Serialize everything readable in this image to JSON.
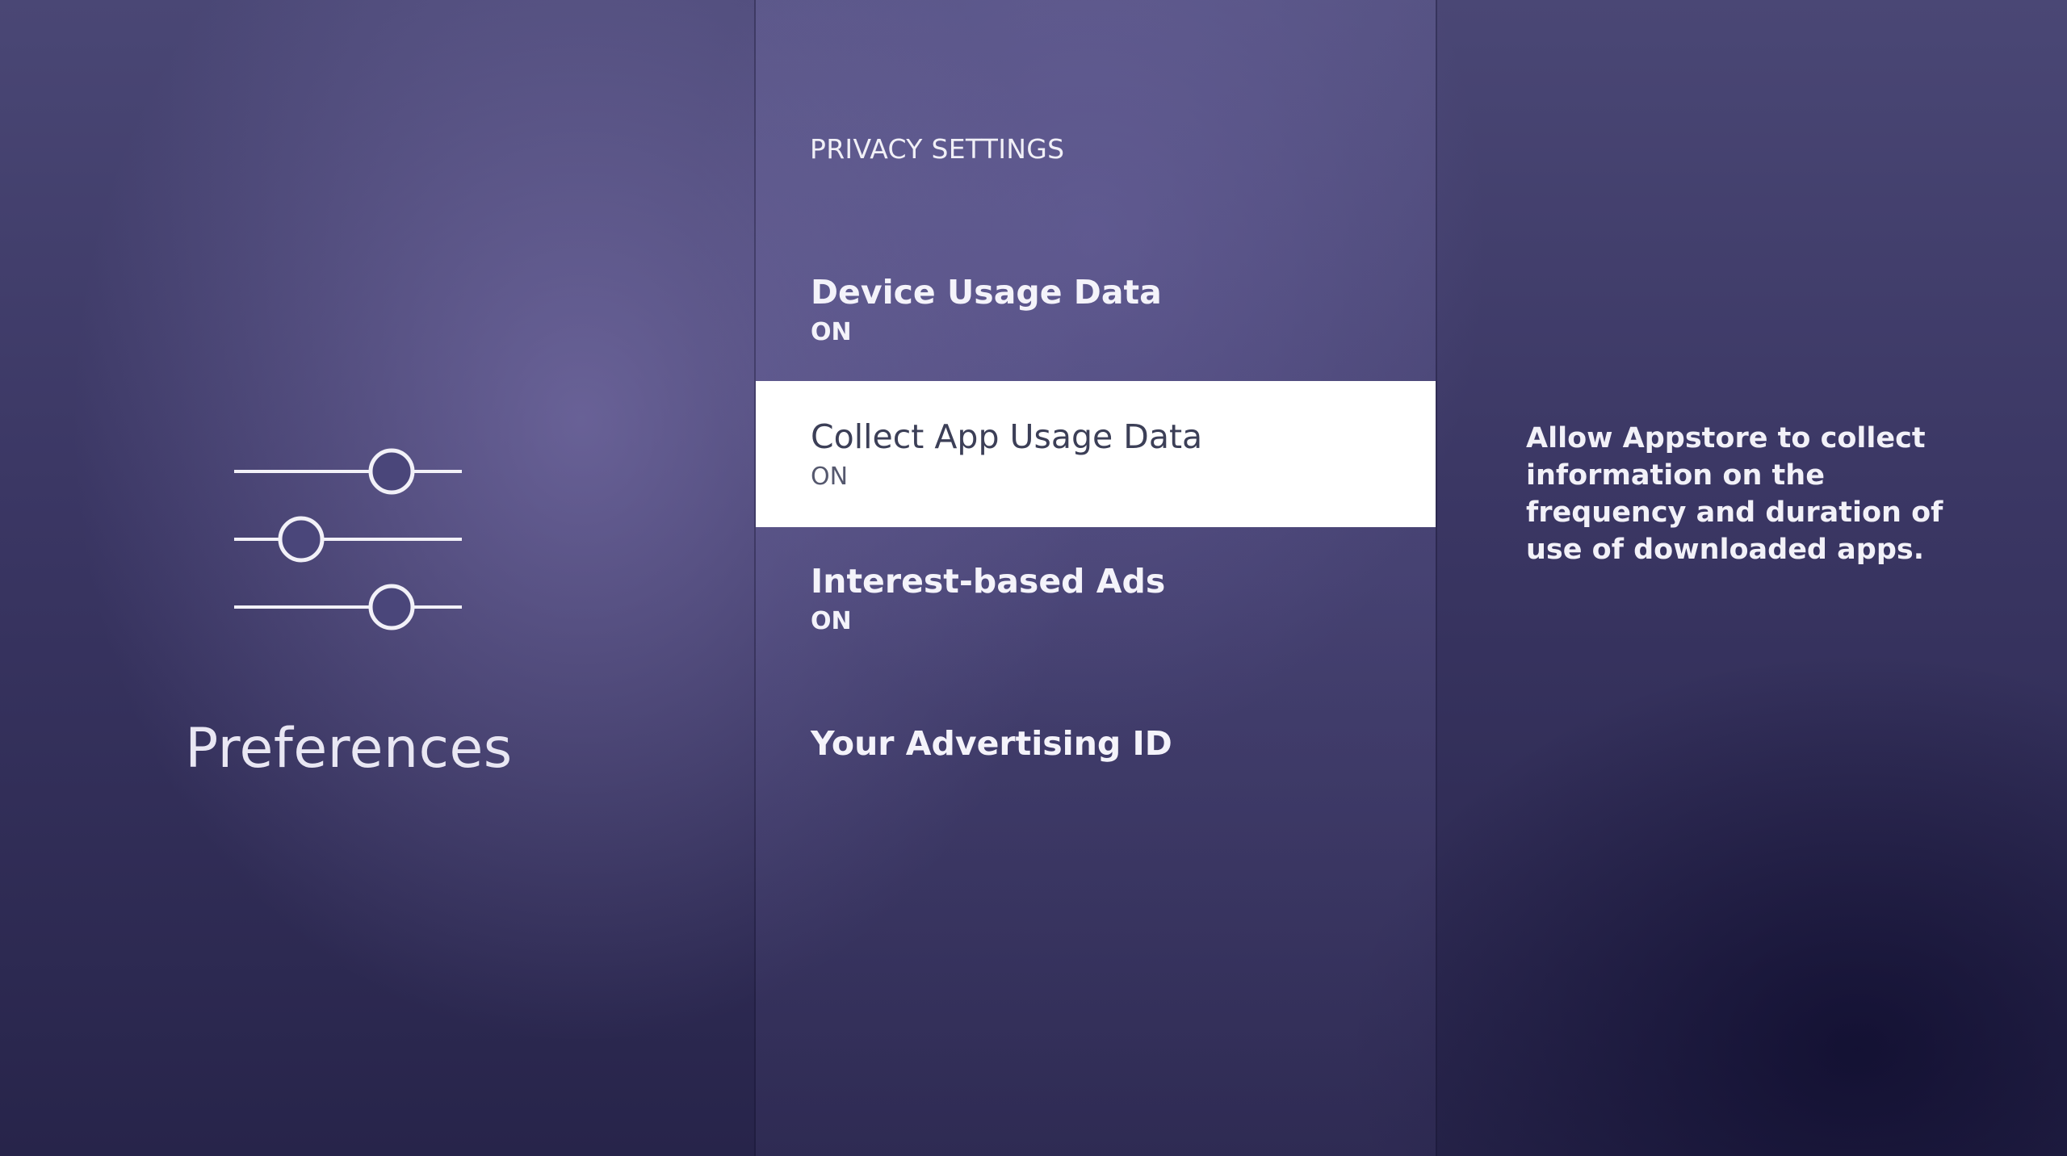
{
  "left_pane": {
    "icon": "sliders-icon",
    "title": "Preferences"
  },
  "privacy": {
    "heading": "PRIVACY SETTINGS",
    "items": [
      {
        "label": "Device Usage Data",
        "value": "ON",
        "selected": false
      },
      {
        "label": "Collect App Usage Data",
        "value": "ON",
        "selected": true
      },
      {
        "label": "Interest-based Ads",
        "value": "ON",
        "selected": false
      },
      {
        "label": "Your Advertising ID",
        "value": "",
        "selected": false
      }
    ]
  },
  "detail": {
    "description": "Allow Appstore to collect information on the frequency and duration of use of downloaded apps."
  },
  "colors": {
    "selection_background": "#ffffff",
    "text_light": "#f4f3fa",
    "text_dark": "#3c3f57"
  }
}
